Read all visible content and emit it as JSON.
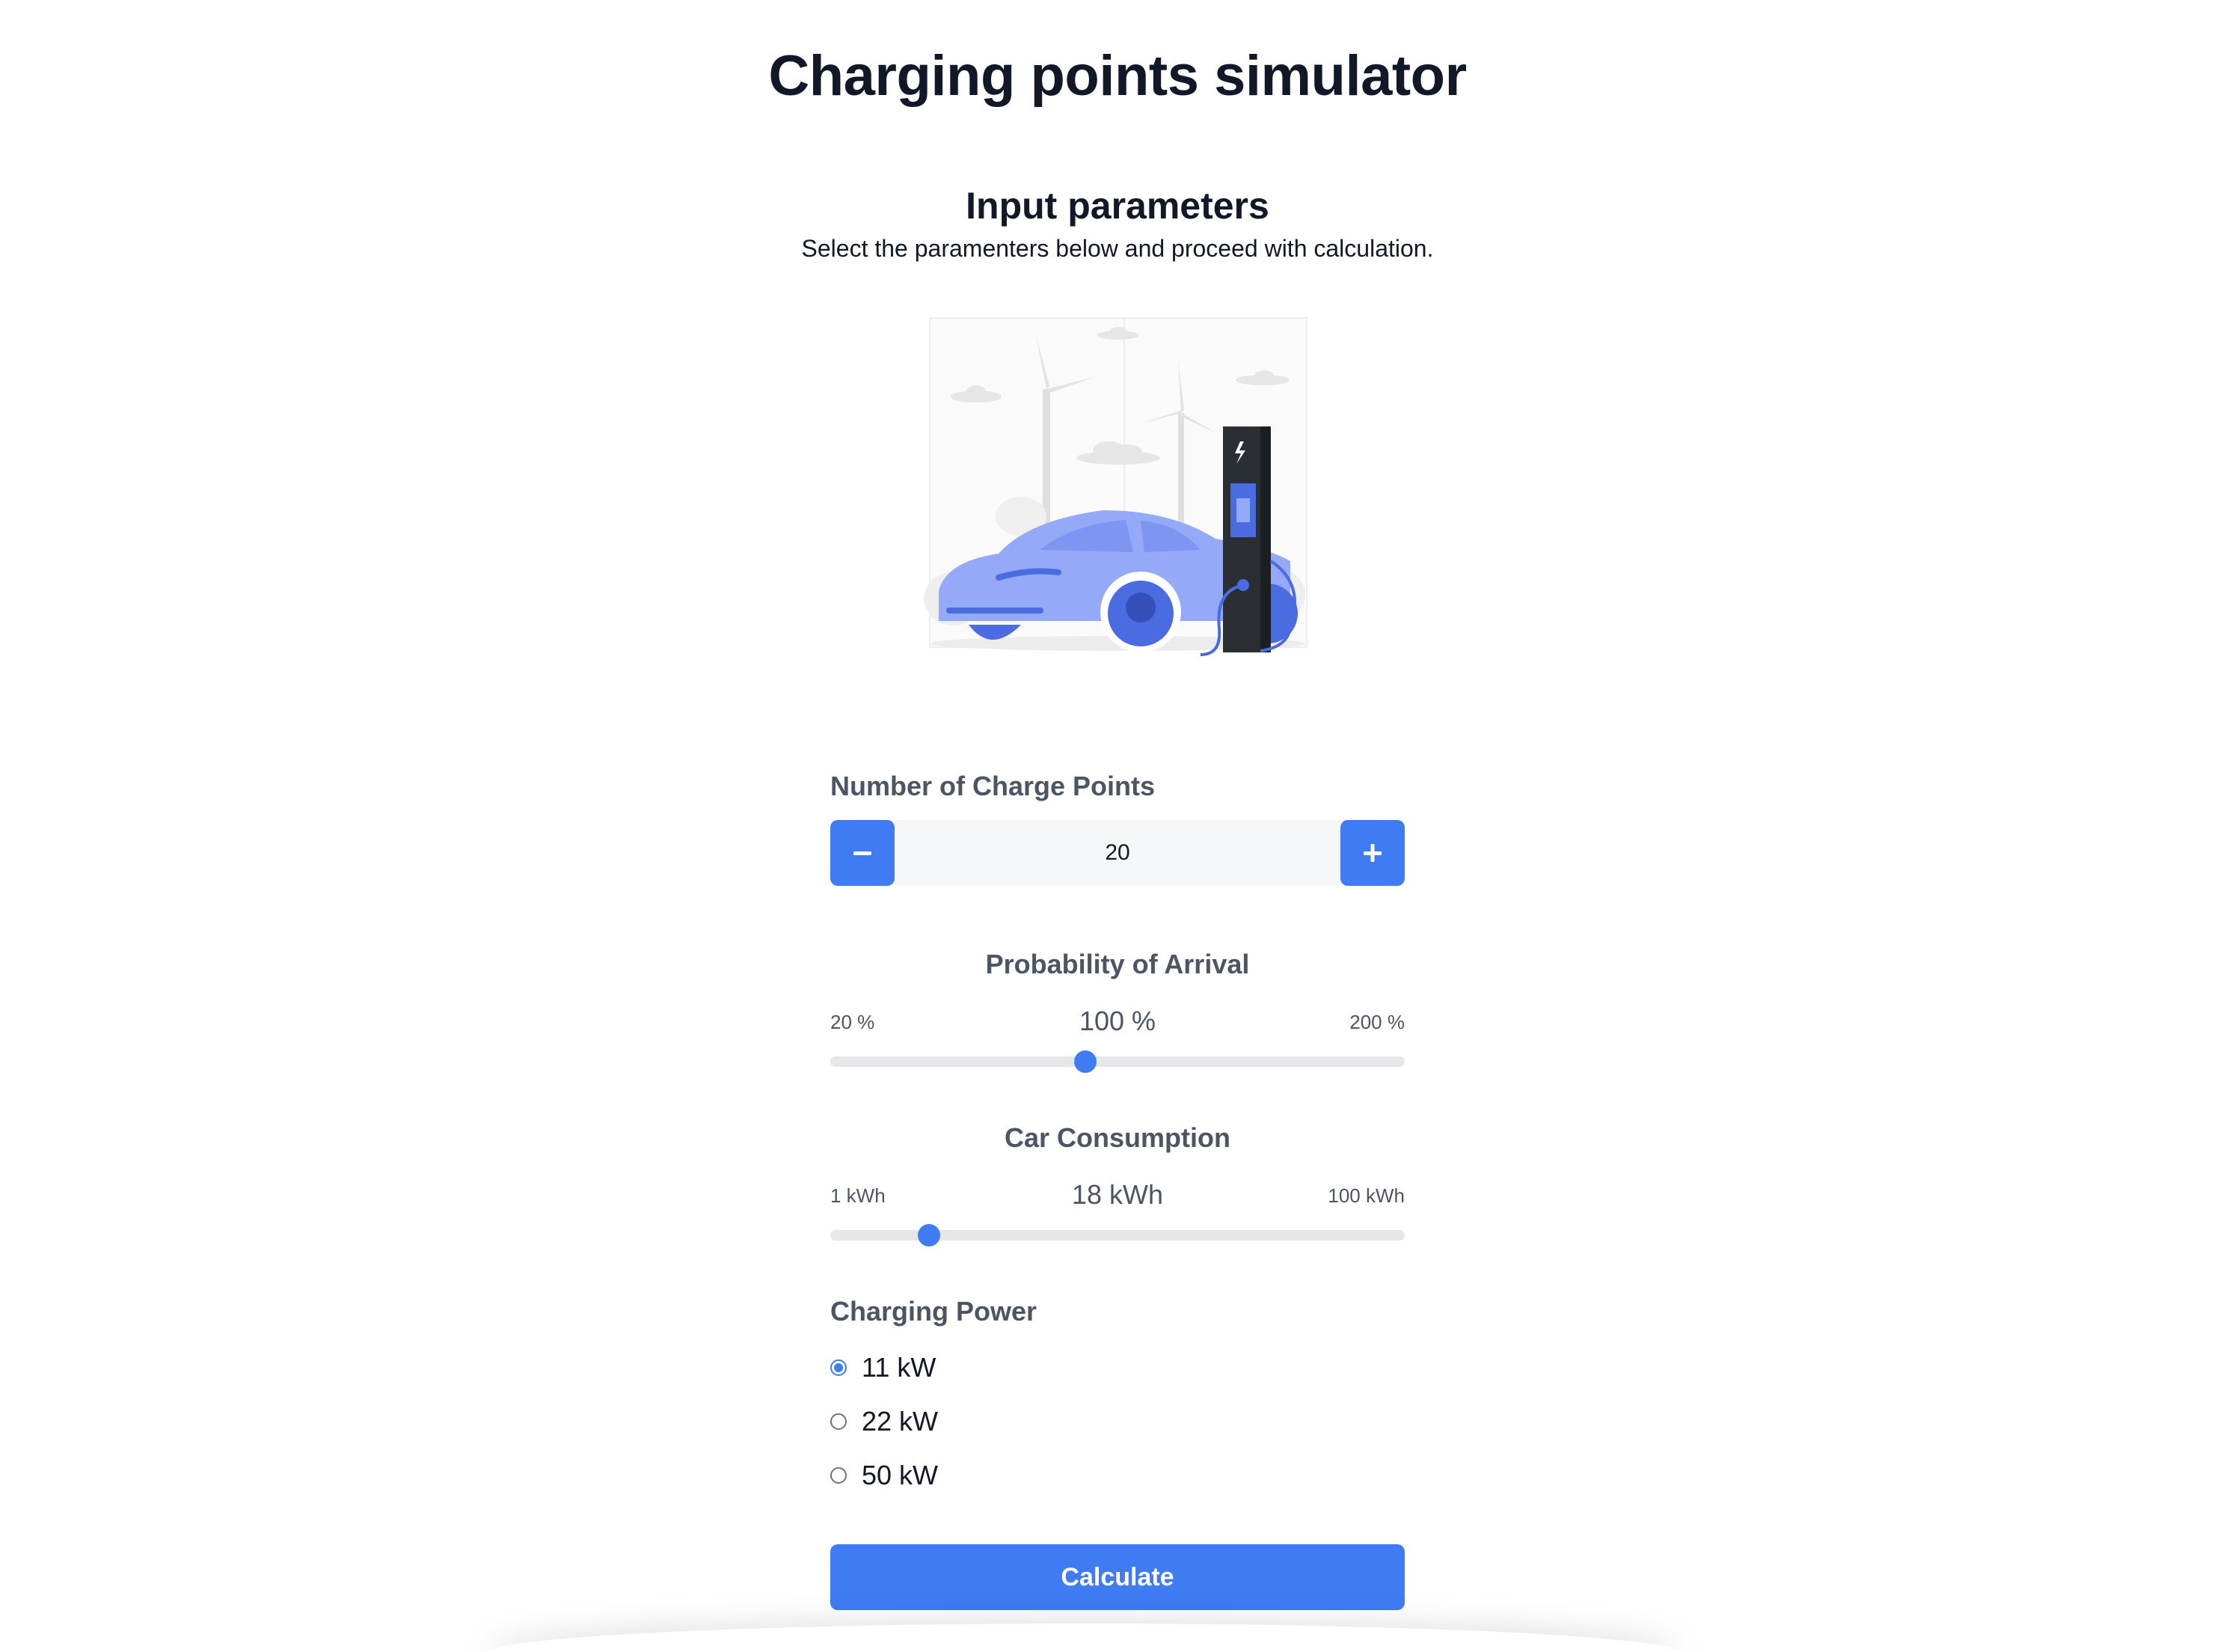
{
  "page": {
    "title": "Charging points simulator"
  },
  "section": {
    "title": "Input parameters",
    "subtitle": "Select the paramenters below and proceed with calculation."
  },
  "charge_points": {
    "label": "Number of Charge Points",
    "value": "20",
    "decrement_icon": "minus-icon",
    "increment_icon": "plus-icon"
  },
  "arrival": {
    "label": "Probability of Arrival",
    "min_label": "20 %",
    "max_label": "200 %",
    "current_label": "100 %",
    "min": 20,
    "max": 200,
    "value": 100
  },
  "consumption": {
    "label": "Car Consumption",
    "min_label": "1 kWh",
    "max_label": "100 kWh",
    "current_label": "18 kWh",
    "min": 1,
    "max": 100,
    "value": 18
  },
  "charging_power": {
    "label": "Charging Power",
    "options": [
      {
        "label": "11 kW",
        "checked": true
      },
      {
        "label": "22 kW",
        "checked": false
      },
      {
        "label": "50 kW",
        "checked": false
      }
    ]
  },
  "calculate": {
    "label": "Calculate"
  },
  "colors": {
    "accent": "#3f7cf4",
    "text": "#111827",
    "muted": "#4b5563",
    "track": "#e5e7eb"
  },
  "illustration": {
    "icon": "ev-charging-station-illustration"
  }
}
